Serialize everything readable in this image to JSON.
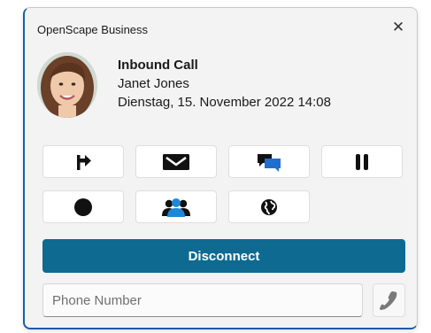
{
  "window": {
    "title": "OpenScape Business",
    "close_symbol": "✕"
  },
  "caller": {
    "status": "Inbound Call",
    "name": "Janet Jones",
    "datetime": "Dienstag, 15. November 2022 14:08",
    "avatar_icon": "caller-photo"
  },
  "actions": [
    {
      "icon": "redirect-icon"
    },
    {
      "icon": "mail-icon"
    },
    {
      "icon": "chat-icon"
    },
    {
      "icon": "pause-icon"
    },
    {
      "icon": "record-icon"
    },
    {
      "icon": "conference-icon"
    },
    {
      "icon": "globe-icon"
    }
  ],
  "disconnect_label": "Disconnect",
  "phone": {
    "placeholder": "Phone Number",
    "value": "",
    "dial_icon": "phone-handset-icon"
  },
  "colors": {
    "accent": "#0f6a92",
    "conference_icon": "#1e88d8",
    "chat_icon": "#1e6fd0"
  }
}
